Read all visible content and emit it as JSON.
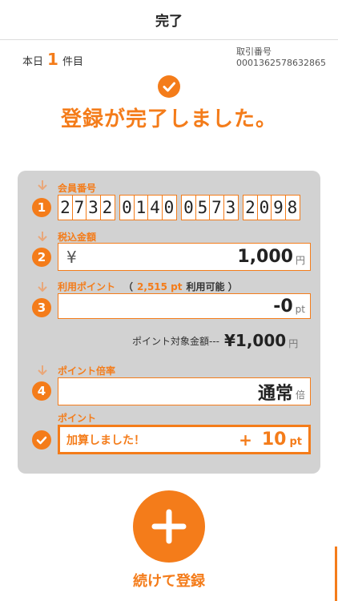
{
  "header": {
    "title": "完了"
  },
  "summary": {
    "today_prefix": "本日",
    "today_count": "1",
    "today_suffix": "件目",
    "transaction_label": "取引番号",
    "transaction_number": "0001362578632865"
  },
  "status": {
    "message": "登録が完了しました。",
    "icon": "check-icon"
  },
  "steps": {
    "member": {
      "number": "1",
      "label": "会員番号",
      "digit_groups": [
        [
          "2",
          "7",
          "3",
          "2"
        ],
        [
          "0",
          "1",
          "4",
          "0"
        ],
        [
          "0",
          "5",
          "7",
          "3"
        ],
        [
          "2",
          "0",
          "9",
          "8"
        ]
      ]
    },
    "amount": {
      "number": "2",
      "label": "税込金額",
      "currency_symbol": "¥",
      "value": "1,000",
      "unit": "円"
    },
    "points_use": {
      "number": "3",
      "label": "利用ポイント",
      "available_open": "（",
      "available_points": "2,515 pt",
      "available_suffix": "利用可能 ）",
      "value": "-0",
      "unit": "pt"
    },
    "target": {
      "label": "ポイント対象金額---",
      "value": "¥1,000",
      "unit": "円"
    },
    "multiplier": {
      "number": "4",
      "label": "ポイント倍率",
      "value": "通常",
      "unit": "倍"
    },
    "points_added": {
      "label": "ポイント",
      "message": "加算しました！",
      "sign": "+",
      "value": "10",
      "unit": "pt"
    }
  },
  "actions": {
    "continue_label": "続けて登録",
    "plus_icon": "plus-icon"
  },
  "colors": {
    "accent": "#f47c1a",
    "panel": "#d2d2d2"
  }
}
